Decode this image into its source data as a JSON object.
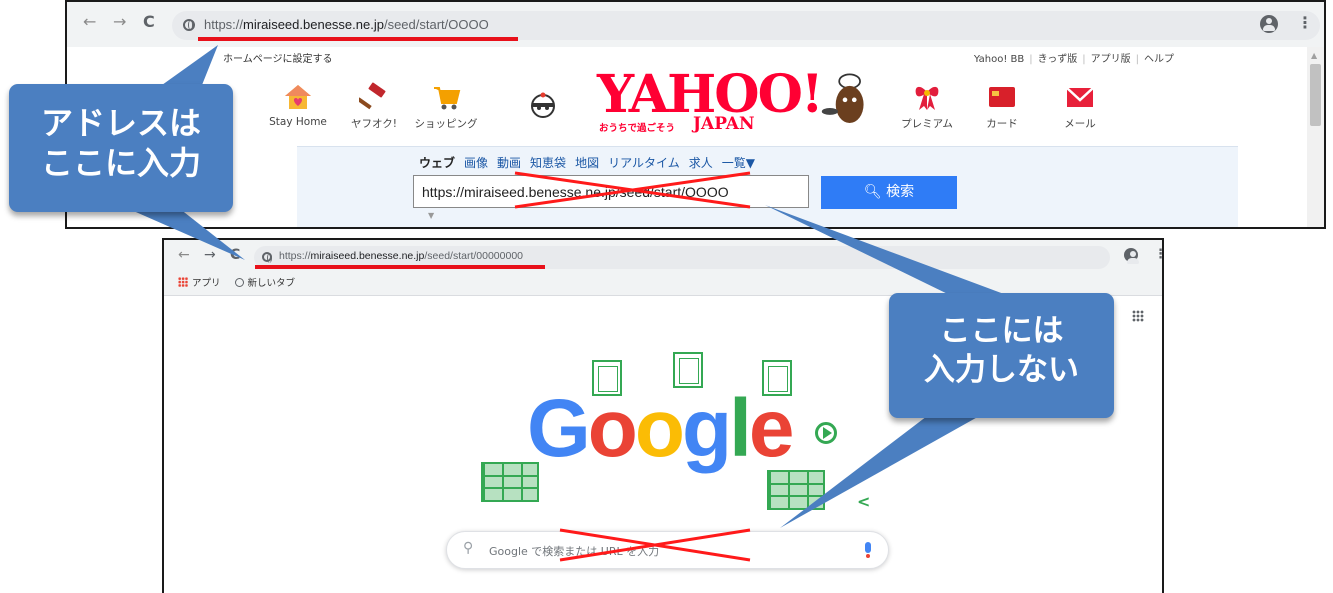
{
  "top_screenshot": {
    "nav": {
      "back": "←",
      "forward": "→",
      "reload": "C"
    },
    "url": {
      "scheme": "https://",
      "host": "miraiseed.benesse.ne.jp",
      "path": "/seed/start/OOOO"
    },
    "profile_menu": "⋮",
    "yahoo": {
      "set_homepage": "ホームページに設定する",
      "top_links": [
        "Yahoo! BB",
        "きっず版",
        "アプリ版",
        "ヘルプ"
      ],
      "services": [
        "Stay Home",
        "ヤフオク!",
        "ショッピング",
        "プレミアム",
        "カード",
        "メール"
      ],
      "logo_text": "YAHOO!",
      "logo_sub": "おうちで過ごそう",
      "logo_japan": "JAPAN",
      "search_tabs": [
        "ウェブ",
        "画像",
        "動画",
        "知恵袋",
        "地図",
        "リアルタイム",
        "求人",
        "一覧▼"
      ],
      "search_value": "https://miraiseed.benesse.ne.jp/seed/start/OOOO",
      "search_button": "検索",
      "search_icon": "magnifier-icon"
    }
  },
  "bottom_screenshot": {
    "nav": {
      "back": "←",
      "forward": "→",
      "reload": "C"
    },
    "url": {
      "scheme": "https://",
      "host": "miraiseed.benesse.ne.jp",
      "path": "/seed/start/00000000"
    },
    "profile_menu": "⋮",
    "bookmarks": [
      "アプリ",
      "新しいタブ"
    ],
    "google": {
      "logo_letters": [
        "G",
        "o",
        "o",
        "g",
        "l",
        "e"
      ],
      "logo_colors": [
        "#4285f4",
        "#ea4335",
        "#fbbc05",
        "#4285f4",
        "#34a853",
        "#ea4335"
      ],
      "search_placeholder": "Google で検索または URL を入力",
      "share_icon": "share-icon"
    }
  },
  "callouts": {
    "address_here": [
      "アドレスは",
      "ここに入力"
    ],
    "not_here": [
      "ここには",
      "入力しない"
    ]
  },
  "colors": {
    "callout": "#4b7fc1",
    "annotation_red": "#e8101a",
    "yahoo_red": "#ff0033",
    "yahoo_search_button": "#2f7cf6"
  }
}
